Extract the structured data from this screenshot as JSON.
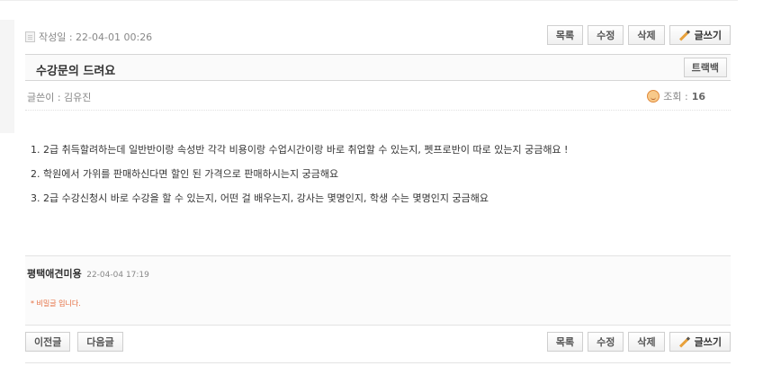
{
  "post": {
    "date_label": "작성일 : 22-04-01 00:26",
    "title": "수강문의 드려요",
    "author_label": "글쓴이 : 김유진",
    "views_label": "조회 :",
    "views_count": "16"
  },
  "toolbar": {
    "list": "목록",
    "edit": "수정",
    "delete": "삭제",
    "write": "글쓰기",
    "trackback": "트랙백"
  },
  "content": {
    "lines": [
      "1. 2급 취득할려하는데 일반반이랑 속성반 각각 비용이랑 수업시간이랑 바로 취업할 수 있는지, 펫프로반이 따로 있는지 궁금해요 !",
      "2. 학원에서 가위를 판매하신다면 할인 된 가격으로 판매하시는지 궁금해요",
      "3. 2급 수강신청시 바로 수강을 할 수 있는지, 어떤 걸 배우는지, 강사는 몇명인지, 학생 수는 몇명인지 궁금해요"
    ]
  },
  "comment": {
    "name": "평택애견미용",
    "date": "22-04-04 17:19",
    "secret": "* 비밀글 입니다."
  },
  "nav": {
    "prev": "이전글",
    "next": "다음글"
  },
  "icons": [
    "document-icon",
    "pencil-icon",
    "smiley-icon"
  ]
}
